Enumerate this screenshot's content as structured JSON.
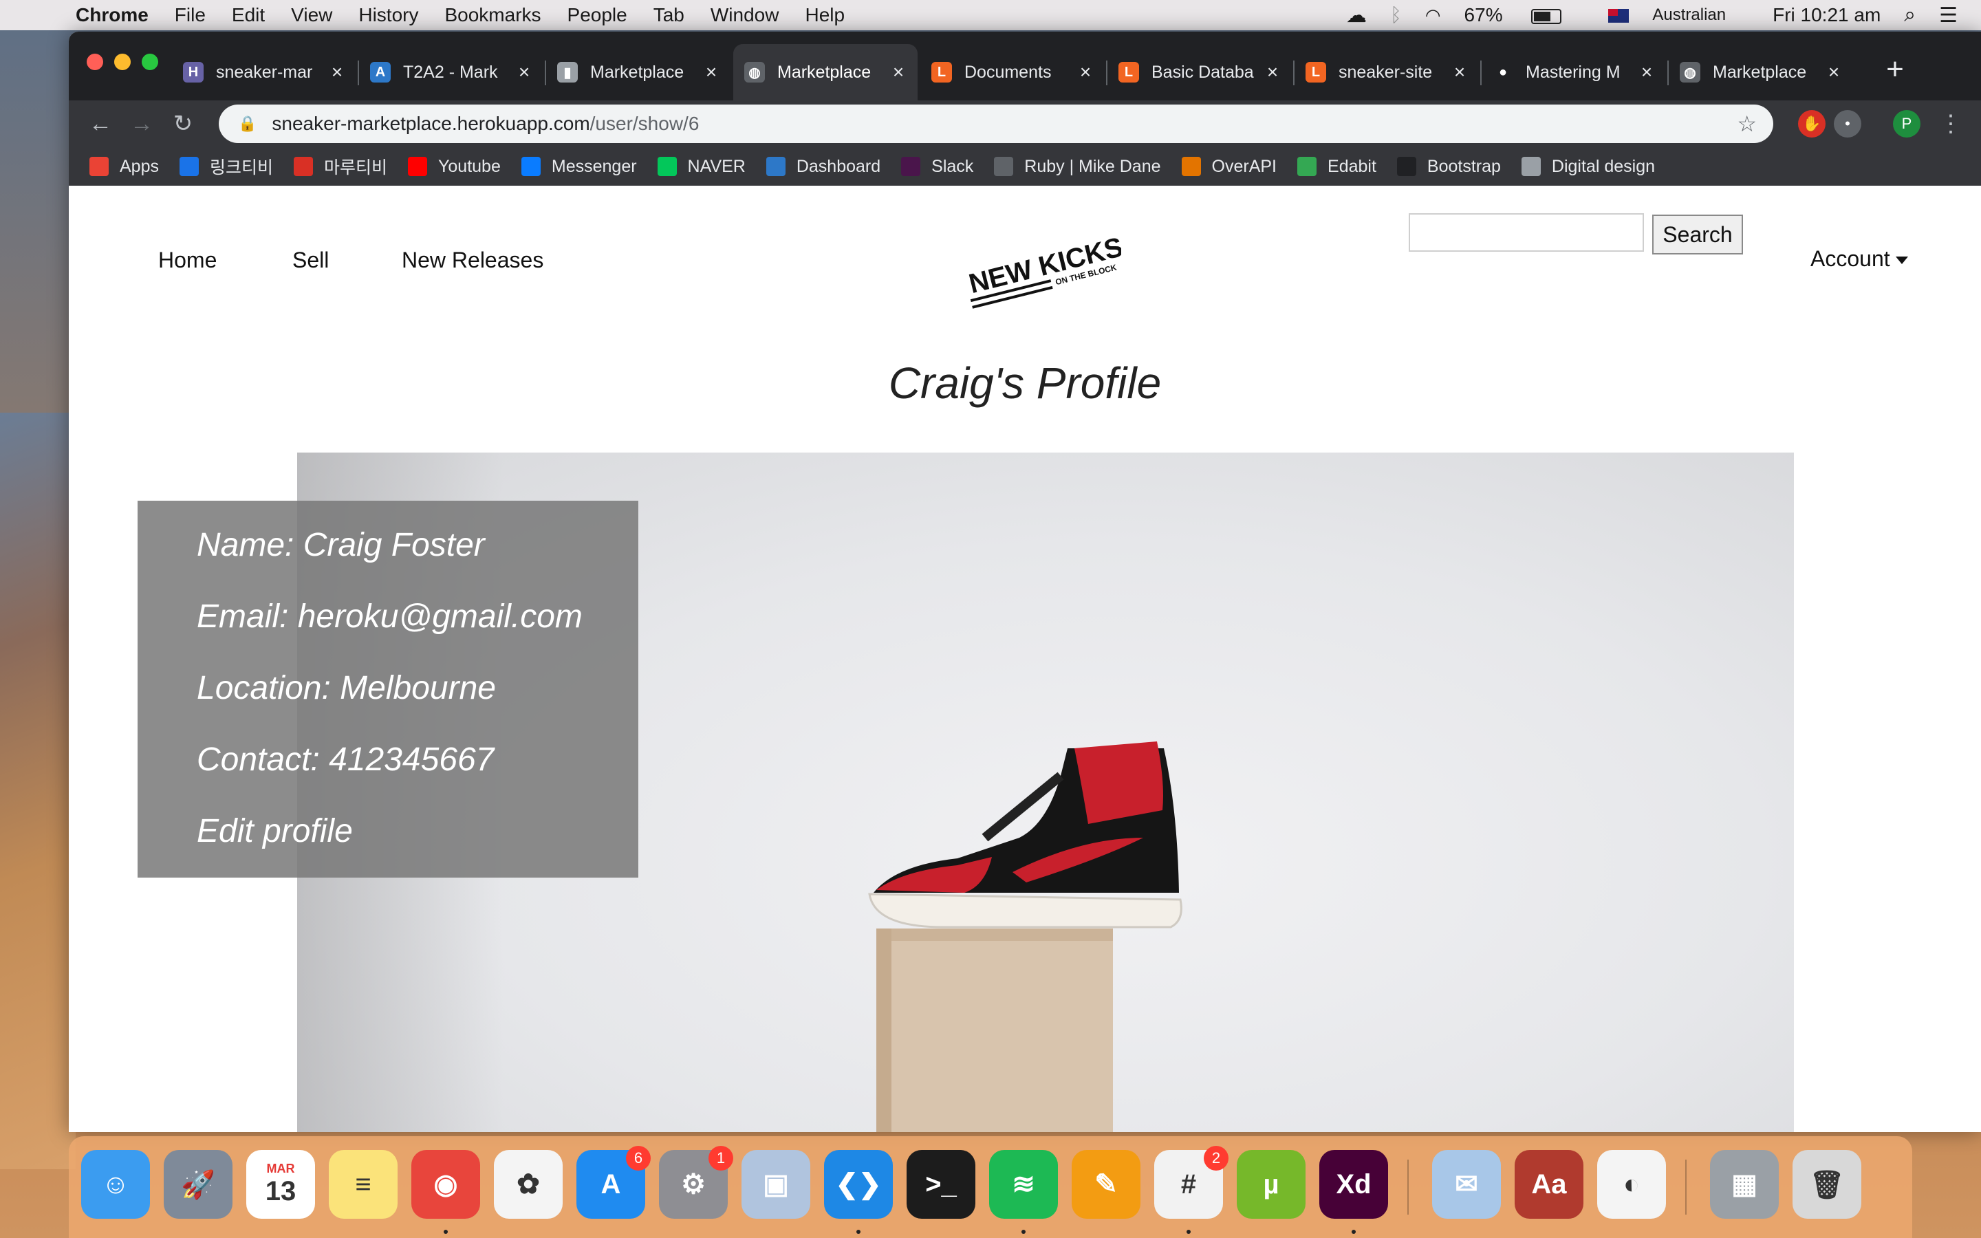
{
  "menubar": {
    "app_name": "Chrome",
    "items": [
      "File",
      "Edit",
      "View",
      "History",
      "Bookmarks",
      "People",
      "Tab",
      "Window",
      "Help"
    ],
    "battery_percent": "67%",
    "battery_level": 0.67,
    "input_source": "Australian",
    "clock": "Fri 10:21 am"
  },
  "tabs": [
    {
      "label": "sneaker-mar",
      "icon": "heroku-icon",
      "color": "#6762a6",
      "glyph": "H"
    },
    {
      "label": "T2A2 - Mark",
      "icon": "canvas-icon",
      "color": "#2d78c8",
      "glyph": "A"
    },
    {
      "label": "Marketplace",
      "icon": "document-icon",
      "color": "#9aa0a6",
      "glyph": "▮"
    },
    {
      "label": "Marketplace",
      "icon": "globe-icon",
      "color": "#5f6368",
      "glyph": "◍",
      "active": true
    },
    {
      "label": "Documents",
      "icon": "lucidchart-icon",
      "color": "#f26522",
      "glyph": "L"
    },
    {
      "label": "Basic Databa",
      "icon": "lucidchart-icon",
      "color": "#f26522",
      "glyph": "L"
    },
    {
      "label": "sneaker-site",
      "icon": "lucidchart-icon",
      "color": "#f26522",
      "glyph": "L"
    },
    {
      "label": "Mastering M",
      "icon": "github-icon",
      "color": "#202124",
      "glyph": "●"
    },
    {
      "label": "Marketplace",
      "icon": "globe-icon",
      "color": "#5f6368",
      "glyph": "◍"
    }
  ],
  "address_bar": {
    "host": "sneaker-marketplace.herokuapp.com",
    "path": "/user/show/6"
  },
  "profile_avatar_letter": "P",
  "bookmarks": [
    {
      "label": "Apps",
      "icon": "apps-grid-icon",
      "color": "#ea4335"
    },
    {
      "label": "링크티비",
      "icon": "play-icon",
      "color": "#1a73e8"
    },
    {
      "label": "마루티비",
      "icon": "tv-icon",
      "color": "#d93025"
    },
    {
      "label": "Youtube",
      "icon": "youtube-icon",
      "color": "#ff0000"
    },
    {
      "label": "Messenger",
      "icon": "messenger-icon",
      "color": "#0a7cff"
    },
    {
      "label": "NAVER",
      "icon": "naver-icon",
      "color": "#03c75a"
    },
    {
      "label": "Dashboard",
      "icon": "canvas-icon",
      "color": "#2d78c8"
    },
    {
      "label": "Slack",
      "icon": "slack-icon",
      "color": "#4a154b"
    },
    {
      "label": "Ruby | Mike Dane",
      "icon": "md-icon",
      "color": "#5f6368"
    },
    {
      "label": "OverAPI",
      "icon": "overapi-icon",
      "color": "#e37400"
    },
    {
      "label": "Edabit",
      "icon": "edabit-icon",
      "color": "#34a853"
    },
    {
      "label": "Bootstrap",
      "icon": "github-icon",
      "color": "#202124"
    },
    {
      "label": "Digital design",
      "icon": "folder-icon",
      "color": "#9aa0a6"
    }
  ],
  "site": {
    "nav": [
      "Home",
      "Sell",
      "New Releases"
    ],
    "logo_main": "NEW KICKS",
    "logo_sub": "ON THE BLOCK",
    "search_placeholder": "",
    "search_button": "Search",
    "account_label": "Account",
    "profile_title": "Craig's Profile",
    "profile": {
      "name": "Name: Craig Foster",
      "email": "Email: heroku@gmail.com",
      "location": "Location: Melbourne",
      "contact": "Contact: 412345667",
      "edit": "Edit profile"
    }
  },
  "dock": [
    {
      "name": "finder-icon",
      "color": "#3b9cf0",
      "glyph": "☺"
    },
    {
      "name": "launchpad-icon",
      "color": "#7f8a99",
      "glyph": "🚀"
    },
    {
      "name": "calendar-icon",
      "color": "#ffffff",
      "glyph": "13",
      "month": "MAR"
    },
    {
      "name": "notes-icon",
      "color": "#fbe37a",
      "glyph": "≡"
    },
    {
      "name": "chrome-icon",
      "color": "#e8453c",
      "glyph": "◉",
      "dot": true
    },
    {
      "name": "photos-icon",
      "color": "#f4f4f4",
      "glyph": "✿"
    },
    {
      "name": "app-store-icon",
      "color": "#1f8bf0",
      "glyph": "A",
      "badge": "6"
    },
    {
      "name": "system-preferences-icon",
      "color": "#8e8e93",
      "glyph": "⚙",
      "badge": "1"
    },
    {
      "name": "preview-icon",
      "color": "#b0c4de",
      "glyph": "▣"
    },
    {
      "name": "vscode-icon",
      "color": "#1e88e5",
      "glyph": "❮❯",
      "dot": true
    },
    {
      "name": "terminal-icon",
      "color": "#1c1c1c",
      "glyph": ">_"
    },
    {
      "name": "spotify-icon",
      "color": "#1db954",
      "glyph": "≋",
      "dot": true
    },
    {
      "name": "pages-icon",
      "color": "#f39c12",
      "glyph": "✎"
    },
    {
      "name": "slack-icon",
      "color": "#f2f2f2",
      "glyph": "#",
      "badge": "2",
      "dot": true
    },
    {
      "name": "utorrent-icon",
      "color": "#76b82a",
      "glyph": "µ"
    },
    {
      "name": "adobe-xd-icon",
      "color": "#470137",
      "glyph": "Xd",
      "dot": true
    },
    {
      "sep": true
    },
    {
      "name": "mail-icon",
      "color": "#a8c7e8",
      "glyph": "✉"
    },
    {
      "name": "dictionary-icon",
      "color": "#b03a2e",
      "glyph": "Aa"
    },
    {
      "name": "sequel-pro-icon",
      "color": "#f4f4f4",
      "glyph": "◐"
    },
    {
      "sep": true
    },
    {
      "name": "downloads-stack-icon",
      "color": "#9aa0a6",
      "glyph": "▦"
    },
    {
      "name": "trash-icon",
      "color": "#d8d8d8",
      "glyph": "🗑"
    }
  ]
}
